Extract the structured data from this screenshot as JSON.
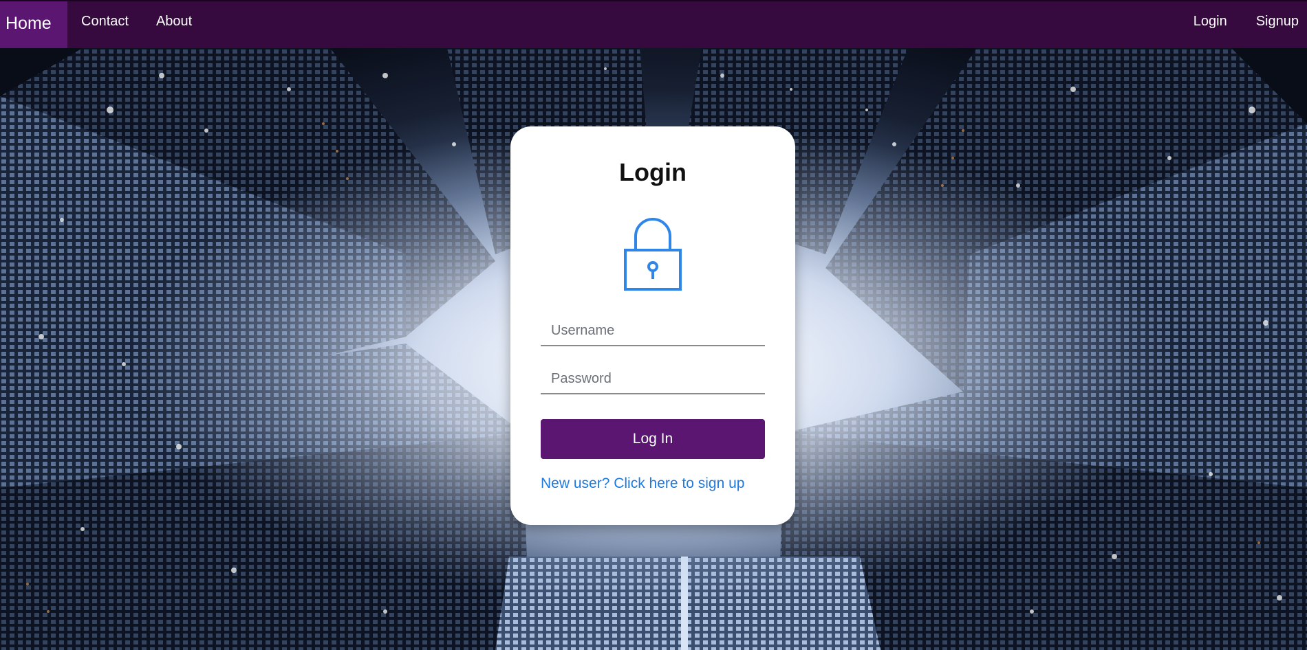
{
  "nav": {
    "home": "Home",
    "contact": "Contact",
    "about": "About",
    "login": "Login",
    "signup": "Signup"
  },
  "card": {
    "title": "Login",
    "username_placeholder": "Username",
    "password_placeholder": "Password",
    "login_button": "Log In",
    "signup_link": "New user? Click here to sign up"
  },
  "icons": {
    "lock": "lock-icon"
  },
  "colors": {
    "navbar": "#360a3f",
    "nav_active": "#5a1670",
    "button": "#5a1670",
    "link": "#1f7ae0",
    "lock_icon": "#2f86e6"
  }
}
